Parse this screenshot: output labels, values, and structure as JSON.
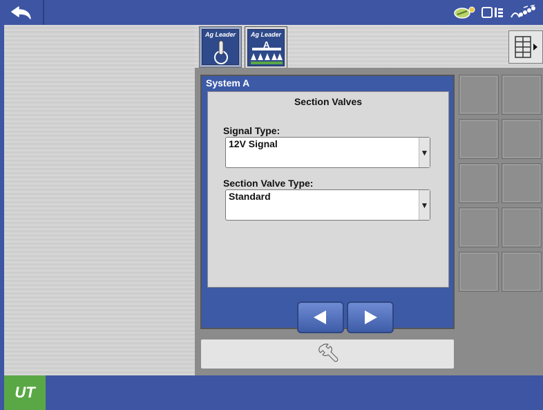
{
  "topbar": {
    "icons": [
      "back-arrow-icon",
      "guidance-icon",
      "display-icon",
      "satellite-icon"
    ]
  },
  "tabs": [
    {
      "brand": "Ag Leader",
      "icon": "switch-icon"
    },
    {
      "brand": "Ag Leader",
      "icon": "sprayer-icon",
      "badge": "A"
    }
  ],
  "dialog": {
    "title": "System A",
    "heading": "Section Valves",
    "signal_type_label": "Signal Type:",
    "signal_type_value": "12V Signal",
    "valve_type_label": "Section Valve Type:",
    "valve_type_value": "Standard",
    "arrow_glyph": "▼"
  },
  "bottombar": {
    "logo_text": "UT"
  },
  "colors": {
    "bar_blue": "#3d55a3",
    "utility_green": "#5aa845",
    "dialog_blue": "#3d5aa6"
  }
}
